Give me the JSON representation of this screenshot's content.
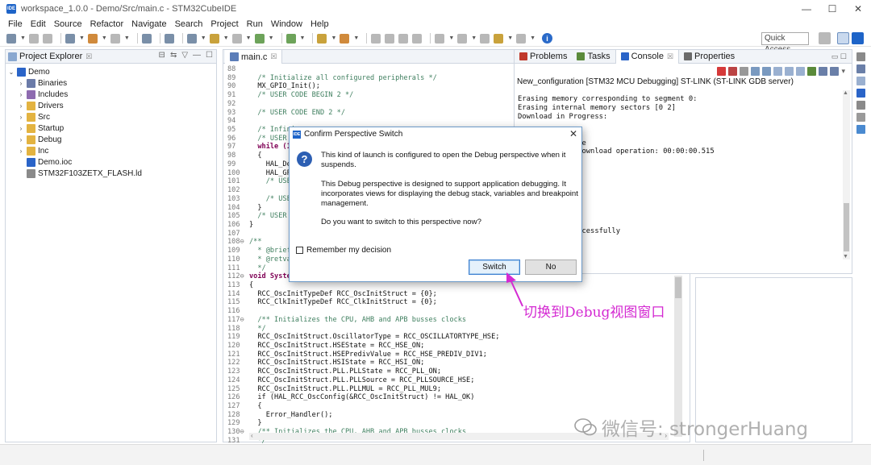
{
  "window": {
    "title": "workspace_1.0.0 - Demo/Src/main.c - STM32CubeIDE",
    "app_icon": "IDE",
    "controls": [
      "—",
      "☐",
      "✕"
    ]
  },
  "menu": [
    "File",
    "Edit",
    "Source",
    "Refactor",
    "Navigate",
    "Search",
    "Project",
    "Run",
    "Window",
    "Help"
  ],
  "toolbar": {
    "quick_access": "Quick Access"
  },
  "project_explorer": {
    "tab_label": "Project Explorer",
    "tab_close": "☒",
    "items": [
      {
        "label": "Demo",
        "twisty": "⌄",
        "icon": "project-icon",
        "color": "#2a64c8"
      },
      {
        "label": "Binaries",
        "twisty": "›",
        "icon": "binaries-icon",
        "color": "#6b7ba8"
      },
      {
        "label": "Includes",
        "twisty": "›",
        "icon": "includes-icon",
        "color": "#8e6bb0"
      },
      {
        "label": "Drivers",
        "twisty": "›",
        "icon": "folder-icon",
        "color": "#e3b341"
      },
      {
        "label": "Src",
        "twisty": "›",
        "icon": "folder-icon",
        "color": "#e3b341"
      },
      {
        "label": "Startup",
        "twisty": "›",
        "icon": "folder-icon",
        "color": "#e3b341"
      },
      {
        "label": "Debug",
        "twisty": "›",
        "icon": "folder-icon",
        "color": "#e3b341"
      },
      {
        "label": "Inc",
        "twisty": "›",
        "icon": "folder-icon",
        "color": "#e3b341"
      },
      {
        "label": "Demo.ioc",
        "twisty": "",
        "icon": "ioc-file-icon",
        "color": "#2a64c8"
      },
      {
        "label": "STM32F103ZETX_FLASH.ld",
        "twisty": "",
        "icon": "ld-file-icon",
        "color": "#8a8a8a"
      }
    ]
  },
  "editor": {
    "tab_label": "main.c",
    "tab_close": "☒",
    "lines": [
      {
        "n": "88",
        "t": "",
        "k": ""
      },
      {
        "n": "89",
        "t": "  /* Initialize all configured peripherals */",
        "k": "comment"
      },
      {
        "n": "90",
        "t": "  MX_GPIO_Init();",
        "k": ""
      },
      {
        "n": "91",
        "t": "  /* USER CODE BEGIN 2 */",
        "k": "comment"
      },
      {
        "n": "92",
        "t": "",
        "k": ""
      },
      {
        "n": "93",
        "t": "  /* USER CODE END 2 */",
        "k": "comment"
      },
      {
        "n": "94",
        "t": "",
        "k": ""
      },
      {
        "n": "95",
        "t": "  /* Infini",
        "k": "comment"
      },
      {
        "n": "96",
        "t": "  /* USER C",
        "k": "comment"
      },
      {
        "n": "97",
        "t": "  while (1)",
        "k": "keyword"
      },
      {
        "n": "98",
        "t": "  {",
        "k": ""
      },
      {
        "n": "99",
        "t": "    HAL_Del",
        "k": ""
      },
      {
        "n": "100",
        "t": "    HAL_GPI",
        "k": ""
      },
      {
        "n": "101",
        "t": "    /* USER",
        "k": "comment"
      },
      {
        "n": "102",
        "t": "",
        "k": ""
      },
      {
        "n": "103",
        "t": "    /* USER",
        "k": "comment"
      },
      {
        "n": "104",
        "t": "  }",
        "k": ""
      },
      {
        "n": "105",
        "t": "  /* USER C",
        "k": "comment"
      },
      {
        "n": "106",
        "t": "}",
        "k": ""
      },
      {
        "n": "107",
        "t": "",
        "k": ""
      },
      {
        "n": "108⊖",
        "t": "/**",
        "k": "comment"
      },
      {
        "n": "109",
        "t": "  * @brief",
        "k": "comment"
      },
      {
        "n": "110",
        "t": "  * @retval",
        "k": "comment"
      },
      {
        "n": "111",
        "t": "  */",
        "k": "comment"
      },
      {
        "n": "112⊖",
        "t": "void System",
        "k": "keyword"
      },
      {
        "n": "113",
        "t": "{",
        "k": ""
      },
      {
        "n": "114",
        "t": "  RCC_OscInitTypeDef RCC_OscInitStruct = {0};",
        "k": ""
      },
      {
        "n": "115",
        "t": "  RCC_ClkInitTypeDef RCC_ClkInitStruct = {0};",
        "k": ""
      },
      {
        "n": "116",
        "t": "",
        "k": ""
      },
      {
        "n": "117⊖",
        "t": "  /** Initializes the CPU, AHB and APB busses clocks",
        "k": "comment"
      },
      {
        "n": "118",
        "t": "  */",
        "k": "comment"
      },
      {
        "n": "119",
        "t": "  RCC_OscInitStruct.OscillatorType = RCC_OSCILLATORTYPE_HSE;",
        "k": ""
      },
      {
        "n": "120",
        "t": "  RCC_OscInitStruct.HSEState = RCC_HSE_ON;",
        "k": ""
      },
      {
        "n": "121",
        "t": "  RCC_OscInitStruct.HSEPredivValue = RCC_HSE_PREDIV_DIV1;",
        "k": ""
      },
      {
        "n": "122",
        "t": "  RCC_OscInitStruct.HSIState = RCC_HSI_ON;",
        "k": ""
      },
      {
        "n": "123",
        "t": "  RCC_OscInitStruct.PLL.PLLState = RCC_PLL_ON;",
        "k": ""
      },
      {
        "n": "124",
        "t": "  RCC_OscInitStruct.PLL.PLLSource = RCC_PLLSOURCE_HSE;",
        "k": ""
      },
      {
        "n": "125",
        "t": "  RCC_OscInitStruct.PLL.PLLMUL = RCC_PLL_MUL9;",
        "k": ""
      },
      {
        "n": "126",
        "t": "  if (HAL_RCC_OscConfig(&RCC_OscInitStruct) != HAL_OK)",
        "k": ""
      },
      {
        "n": "127",
        "t": "  {",
        "k": ""
      },
      {
        "n": "128",
        "t": "    Error_Handler();",
        "k": ""
      },
      {
        "n": "129",
        "t": "  }",
        "k": ""
      },
      {
        "n": "130⊖",
        "t": "  /** Initializes the CPU, AHB and APB busses clocks",
        "k": "comment"
      },
      {
        "n": "131",
        "t": "  */",
        "k": "comment"
      }
    ]
  },
  "console_view": {
    "tabs": [
      {
        "label": "Problems",
        "icon": "problems-icon",
        "color": "#c0392b",
        "active": false
      },
      {
        "label": "Tasks",
        "icon": "tasks-icon",
        "color": "#5a8a3a",
        "active": false
      },
      {
        "label": "Console",
        "icon": "console-icon",
        "color": "#2a64c8",
        "active": true
      },
      {
        "label": "Properties",
        "icon": "properties-icon",
        "color": "#6a6a6a",
        "active": false
      }
    ],
    "header": "New_configuration [STM32 MCU Debugging] ST-LINK (ST-LINK GDB server)",
    "output": "Erasing memory corresponding to segment 0:\nErasing internal memory sectors [0 2]\nDownload in Progress:\n\n\n          mplete\n          ing download operation: 00:00:00.515\n\n\n\n\n\n\n\n\n          d successfully"
  },
  "dialog": {
    "title": "Confirm Perspective Switch",
    "icon": "IDE",
    "close": "✕",
    "question_icon": "?",
    "para1": "This kind of launch is configured to open the Debug perspective when it suspends.",
    "para2": "This Debug perspective is designed to support application debugging. It incorporates views for displaying the debug stack, variables and breakpoint management.",
    "para3": "Do you want to switch to this perspective now?",
    "remember_label": "Remember my decision",
    "switch_label": "Switch",
    "no_label": "No"
  },
  "annotation": {
    "text": "切换到Debug视图窗口",
    "color": "#d42ad2"
  },
  "watermark": {
    "text": "微信号: strongerHuang"
  }
}
